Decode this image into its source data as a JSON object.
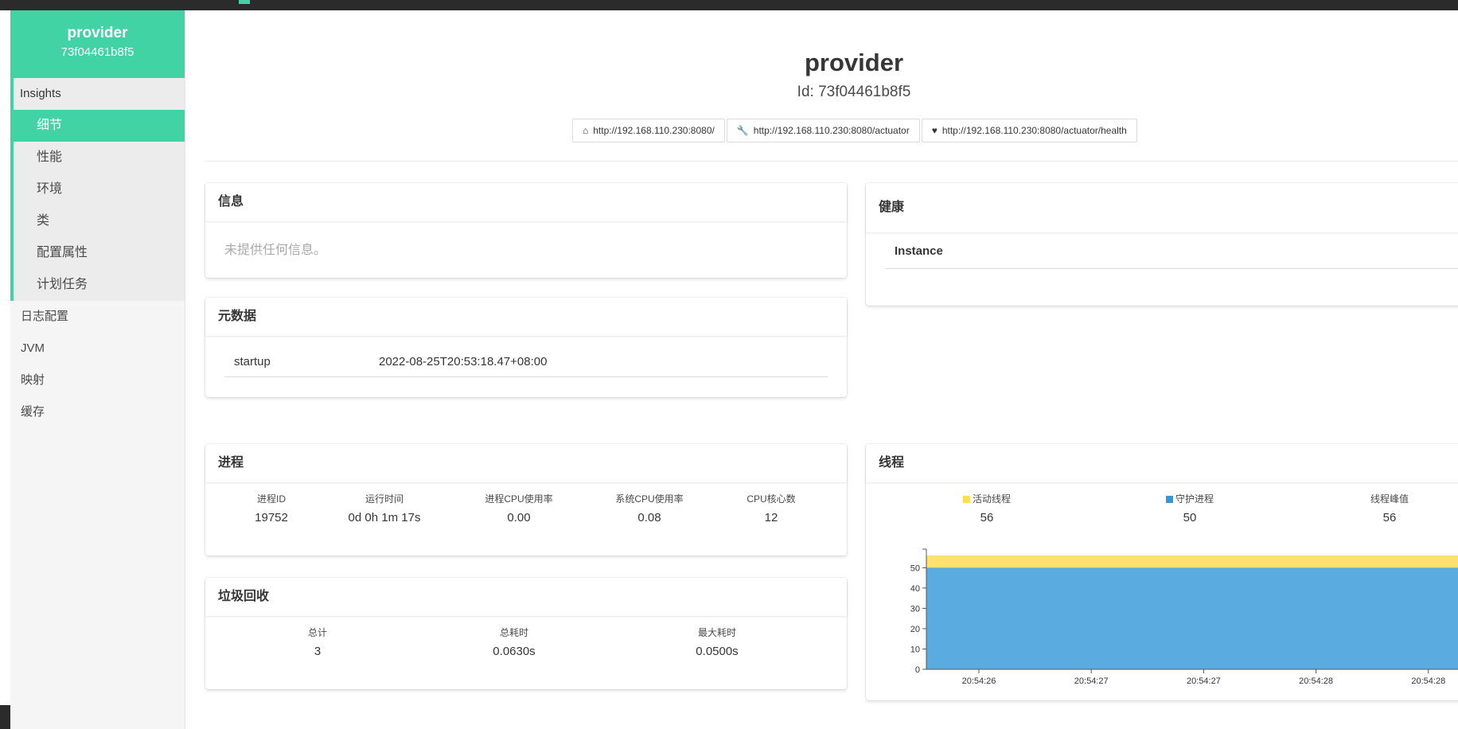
{
  "app": {
    "name": "provider",
    "id": "73f04461b8f5"
  },
  "sidebar": {
    "insights_label": "Insights",
    "insights_items": [
      "细节",
      "性能",
      "环境",
      "类",
      "配置属性",
      "计划任务"
    ],
    "active_index": 0,
    "items": [
      "日志配置",
      "JVM",
      "映射",
      "缓存"
    ]
  },
  "header": {
    "title": "provider",
    "subtitle": "Id: 73f04461b8f5",
    "links": [
      {
        "icon": "home-icon",
        "text": "http://192.168.110.230:8080/"
      },
      {
        "icon": "wrench-icon",
        "text": "http://192.168.110.230:8080/actuator"
      },
      {
        "icon": "heartbeat-icon",
        "text": "http://192.168.110.230:8080/actuator/health"
      }
    ]
  },
  "info": {
    "title": "信息",
    "empty_text": "未提供任何信息。"
  },
  "metadata": {
    "title": "元数据",
    "rows": [
      {
        "key": "startup",
        "value": "2022-08-25T20:53:18.47+08:00"
      }
    ]
  },
  "health": {
    "title": "健康",
    "instance_label": "Instance"
  },
  "process": {
    "title": "进程",
    "stats": [
      {
        "label": "进程ID",
        "value": "19752"
      },
      {
        "label": "运行时间",
        "value": "0d 0h 1m 17s"
      },
      {
        "label": "进程CPU使用率",
        "value": "0.00"
      },
      {
        "label": "系统CPU使用率",
        "value": "0.08"
      },
      {
        "label": "CPU核心数",
        "value": "12"
      }
    ]
  },
  "gc": {
    "title": "垃圾回收",
    "stats": [
      {
        "label": "总计",
        "value": "3"
      },
      {
        "label": "总耗时",
        "value": "0.0630s"
      },
      {
        "label": "最大耗时",
        "value": "0.0500s"
      }
    ]
  },
  "threads": {
    "title": "线程",
    "stats": [
      {
        "label": "活动线程",
        "value": "56",
        "color": "#ffdd57"
      },
      {
        "label": "守护进程",
        "value": "50",
        "color": "#3298dc"
      },
      {
        "label": "线程峰值",
        "value": "56"
      }
    ]
  },
  "colors": {
    "accent": "#42d3a5",
    "live": "#ffe16e",
    "daemon": "#5aabe0"
  },
  "chart_data": {
    "type": "area",
    "x": [
      "20:54:26",
      "20:54:27",
      "20:54:27",
      "20:54:28",
      "20:54:28"
    ],
    "series": [
      {
        "name": "守护进程",
        "values": [
          50,
          50,
          50,
          50,
          50
        ]
      },
      {
        "name": "活动线程",
        "values": [
          56,
          56,
          56,
          56,
          56
        ]
      }
    ],
    "ylim": [
      0,
      56
    ],
    "yticks": [
      0,
      10,
      20,
      30,
      40,
      50
    ],
    "xticks": [
      "20:54:26",
      "20:54:27",
      "20:54:27",
      "20:54:28",
      "20:54:28"
    ]
  }
}
